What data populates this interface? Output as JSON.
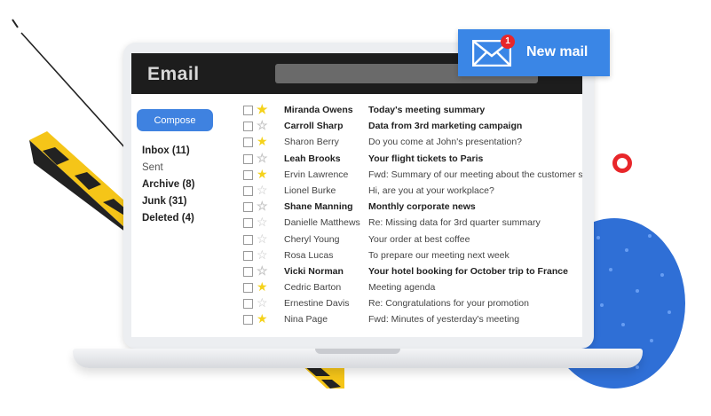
{
  "app": {
    "title": "Email"
  },
  "sidebar": {
    "compose_label": "Compose",
    "folders": [
      {
        "label": "Inbox (11)",
        "bold": true
      },
      {
        "label": "Sent",
        "bold": false
      },
      {
        "label": "Archive (8)",
        "bold": true
      },
      {
        "label": "Junk (31)",
        "bold": true
      },
      {
        "label": "Deleted (4)",
        "bold": true
      }
    ]
  },
  "mails": [
    {
      "sender": "Miranda Owens",
      "subject": "Today's meeting summary",
      "unread": true,
      "starred": true
    },
    {
      "sender": "Carroll Sharp",
      "subject": "Data from 3rd marketing campaign",
      "unread": true,
      "starred": false
    },
    {
      "sender": "Sharon Berry",
      "subject": "Do you come at John's presentation?",
      "unread": false,
      "starred": true
    },
    {
      "sender": "Leah Brooks",
      "subject": "Your flight tickets to Paris",
      "unread": true,
      "starred": false
    },
    {
      "sender": "Ervin Lawrence",
      "subject": "Fwd: Summary of our meeting about the customer su",
      "unread": false,
      "starred": true
    },
    {
      "sender": "Lionel Burke",
      "subject": "Hi, are you at your workplace?",
      "unread": false,
      "starred": false
    },
    {
      "sender": "Shane Manning",
      "subject": "Monthly corporate news",
      "unread": true,
      "starred": false
    },
    {
      "sender": "Danielle Matthews",
      "subject": "Re: Missing data for 3rd quarter summary",
      "unread": false,
      "starred": false
    },
    {
      "sender": "Cheryl Young",
      "subject": "Your order at best coffee",
      "unread": false,
      "starred": false
    },
    {
      "sender": "Rosa Lucas",
      "subject": "To prepare our meeting next week",
      "unread": false,
      "starred": false
    },
    {
      "sender": "Vicki Norman",
      "subject": "Your hotel booking for October trip to France",
      "unread": true,
      "starred": false
    },
    {
      "sender": "Cedric Barton",
      "subject": "Meeting agenda",
      "unread": false,
      "starred": true
    },
    {
      "sender": "Ernestine Davis",
      "subject": "Re: Congratulations for your promotion",
      "unread": false,
      "starred": false
    },
    {
      "sender": "Nina Page",
      "subject": "Fwd: Minutes of yesterday's meeting",
      "unread": false,
      "starred": true
    }
  ],
  "notification": {
    "label": "New mail",
    "badge_count": "1"
  },
  "icons": {
    "star": "star-icon",
    "checkbox": "checkbox-icon",
    "envelope": "envelope-icon"
  },
  "colors": {
    "accent": "#3a86e6",
    "compose": "#3f82e0",
    "header": "#1d1d1d",
    "badge": "#e8262a",
    "star_on": "#f5d21b",
    "star_off": "#c4c4c4"
  }
}
